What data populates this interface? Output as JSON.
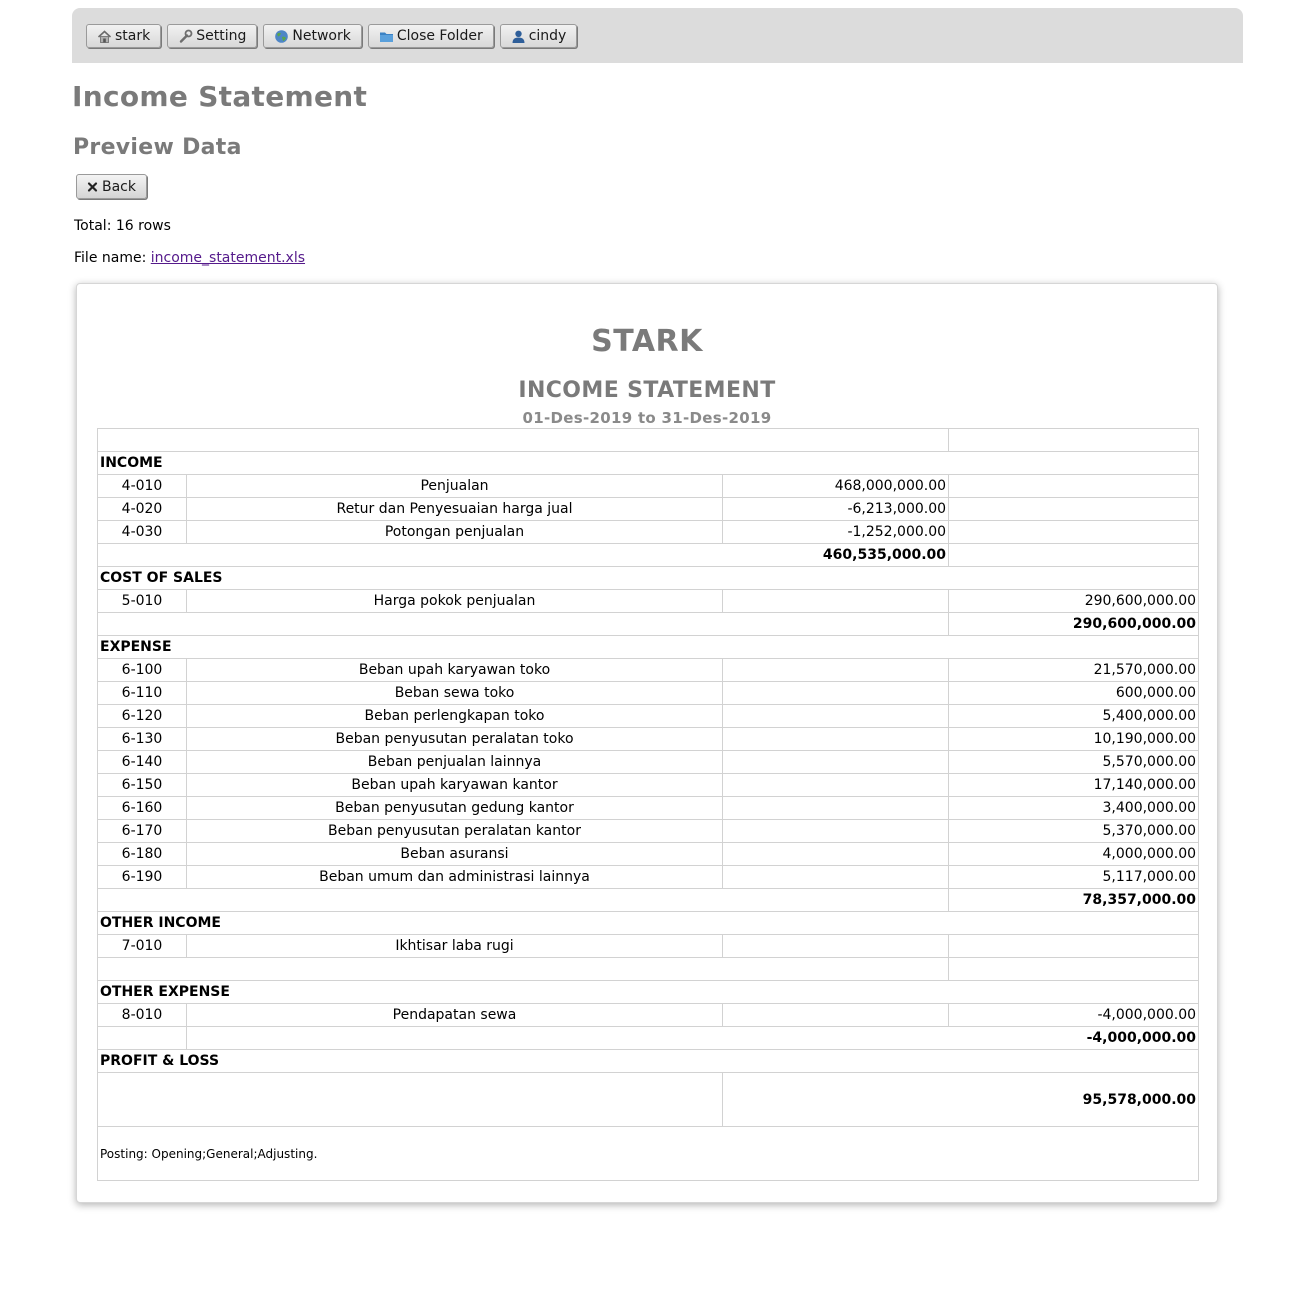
{
  "nav": {
    "buttons": [
      {
        "label": "stark",
        "icon": "home-icon"
      },
      {
        "label": "Setting",
        "icon": "wrench-icon"
      },
      {
        "label": "Network",
        "icon": "globe-icon"
      },
      {
        "label": "Close Folder",
        "icon": "folder-icon"
      },
      {
        "label": "cindy",
        "icon": "user-icon"
      }
    ]
  },
  "page": {
    "title": "Income Statement",
    "subtitle": "Preview Data",
    "back_label": "Back",
    "total_text": "Total: 16 rows",
    "file_label": "File name:",
    "file_name": "income_statement.xls"
  },
  "report": {
    "company": "STARK",
    "title": "INCOME STATEMENT",
    "period": "01-Des-2019 to 31-Des-2019",
    "sections": {
      "income": {
        "heading": "INCOME",
        "rows": [
          {
            "code": "4-010",
            "name": "Penjualan",
            "amount": "468,000,000.00"
          },
          {
            "code": "4-020",
            "name": "Retur dan Penyesuaian harga jual",
            "amount": "-6,213,000.00"
          },
          {
            "code": "4-030",
            "name": "Potongan penjualan",
            "amount": "-1,252,000.00"
          }
        ],
        "total": "460,535,000.00"
      },
      "cost_of_sales": {
        "heading": "COST OF SALES",
        "rows": [
          {
            "code": "5-010",
            "name": "Harga pokok penjualan",
            "amount": "290,600,000.00"
          }
        ],
        "total": "290,600,000.00"
      },
      "expense": {
        "heading": "EXPENSE",
        "rows": [
          {
            "code": "6-100",
            "name": "Beban upah karyawan toko",
            "amount": "21,570,000.00"
          },
          {
            "code": "6-110",
            "name": "Beban sewa toko",
            "amount": "600,000.00"
          },
          {
            "code": "6-120",
            "name": "Beban perlengkapan toko",
            "amount": "5,400,000.00"
          },
          {
            "code": "6-130",
            "name": "Beban penyusutan peralatan toko",
            "amount": "10,190,000.00"
          },
          {
            "code": "6-140",
            "name": "Beban penjualan lainnya",
            "amount": "5,570,000.00"
          },
          {
            "code": "6-150",
            "name": "Beban upah karyawan kantor",
            "amount": "17,140,000.00"
          },
          {
            "code": "6-160",
            "name": "Beban penyusutan gedung kantor",
            "amount": "3,400,000.00"
          },
          {
            "code": "6-170",
            "name": "Beban penyusutan peralatan kantor",
            "amount": "5,370,000.00"
          },
          {
            "code": "6-180",
            "name": "Beban asuransi",
            "amount": "4,000,000.00"
          },
          {
            "code": "6-190",
            "name": "Beban umum dan administrasi lainnya",
            "amount": "5,117,000.00"
          }
        ],
        "total": "78,357,000.00"
      },
      "other_income": {
        "heading": "OTHER INCOME",
        "rows": [
          {
            "code": "7-010",
            "name": "Ikhtisar laba rugi",
            "amount": ""
          }
        ],
        "total": ""
      },
      "other_expense": {
        "heading": "OTHER EXPENSE",
        "rows": [
          {
            "code": "8-010",
            "name": "Pendapatan sewa",
            "amount": "-4,000,000.00"
          }
        ],
        "total": "-4,000,000.00"
      },
      "profit_loss": {
        "heading": "PROFIT & LOSS",
        "total": "95,578,000.00"
      }
    },
    "posting_note": "Posting: Opening;General;Adjusting."
  }
}
